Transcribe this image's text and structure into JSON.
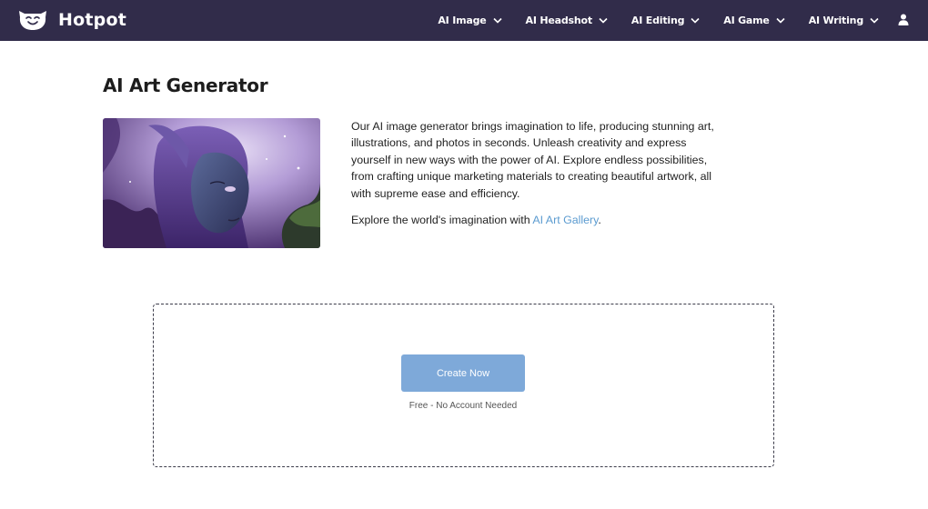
{
  "brand": {
    "name": "Hotpot"
  },
  "nav": {
    "items": [
      {
        "label": "AI Image"
      },
      {
        "label": "AI Headshot"
      },
      {
        "label": "AI Editing"
      },
      {
        "label": "AI Game"
      },
      {
        "label": "AI Writing"
      }
    ],
    "user_icon": "user-icon"
  },
  "page": {
    "title": "AI Art Generator",
    "hero_image": "fantasy-elf-portrait",
    "intro_paragraph": "Our AI image generator brings imagination to life, producing stunning art, illustrations, and photos in seconds. Unleash creativity and express yourself in new ways with the power of AI. Explore endless possibilities, from crafting unique marketing materials to creating beautiful artwork, all with supreme ease and efficiency.",
    "explore_prefix": "Explore the world's imagination with ",
    "gallery_link": "AI Art Gallery",
    "explore_suffix": "."
  },
  "create": {
    "button_label": "Create Now",
    "note": "Free - No Account Needed"
  },
  "colors": {
    "navbar": "#312c4a",
    "button": "#7ea9d9",
    "link": "#5b9bd0"
  }
}
